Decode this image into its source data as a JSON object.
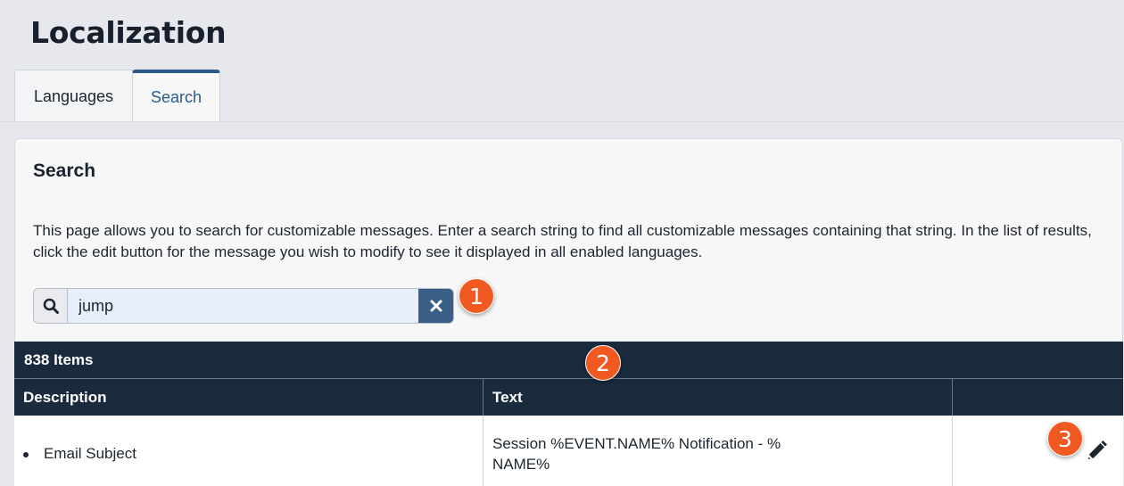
{
  "page": {
    "title": "Localization"
  },
  "tabs": [
    {
      "label": "Languages",
      "active": false
    },
    {
      "label": "Search",
      "active": true
    }
  ],
  "panel": {
    "title": "Search",
    "description": "This page allows you to search for customizable messages. Enter a search string to find all customizable messages containing that string. In the list of results, click the edit button for the message you wish to modify to see it displayed in all enabled languages."
  },
  "search": {
    "value": "jump",
    "icon": "search-icon",
    "clear_icon": "close-icon"
  },
  "callouts": [
    "1",
    "2",
    "3"
  ],
  "results": {
    "count_label": "838 Items",
    "columns": [
      "Description",
      "Text",
      ""
    ],
    "rows": [
      {
        "description": "Email Subject",
        "text": "Session %EVENT.NAME% Notification - %  NAME%",
        "action_icon": "pencil-icon"
      }
    ]
  },
  "colors": {
    "header_bg": "#1a2b3e",
    "accent": "#2a5a8a",
    "clear_button": "#3a5f87",
    "callout": "#f05a22",
    "input_bg": "#e6eefb"
  }
}
